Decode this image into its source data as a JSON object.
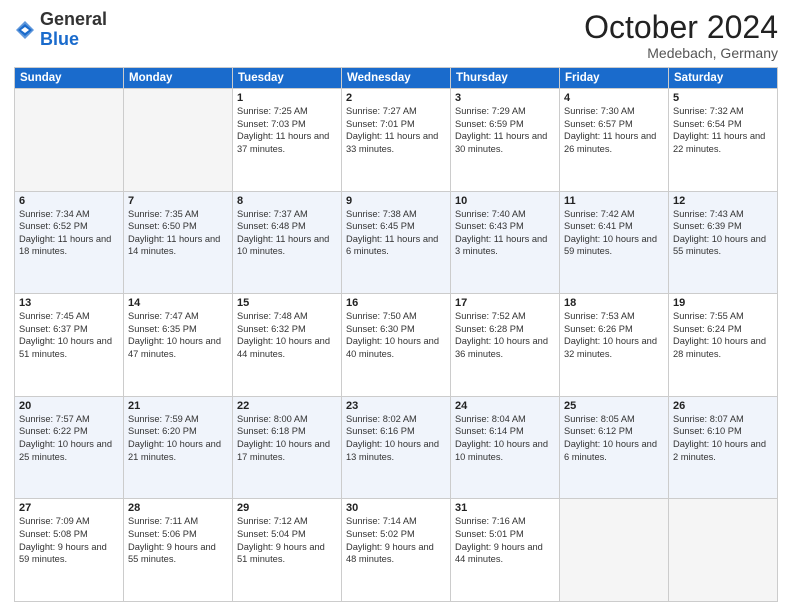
{
  "header": {
    "logo": {
      "line1": "General",
      "line2": "Blue"
    },
    "title": "October 2024",
    "location": "Medebach, Germany"
  },
  "weekdays": [
    "Sunday",
    "Monday",
    "Tuesday",
    "Wednesday",
    "Thursday",
    "Friday",
    "Saturday"
  ],
  "weeks": [
    [
      {
        "day": "",
        "info": ""
      },
      {
        "day": "",
        "info": ""
      },
      {
        "day": "1",
        "info": "Sunrise: 7:25 AM\nSunset: 7:03 PM\nDaylight: 11 hours\nand 37 minutes."
      },
      {
        "day": "2",
        "info": "Sunrise: 7:27 AM\nSunset: 7:01 PM\nDaylight: 11 hours\nand 33 minutes."
      },
      {
        "day": "3",
        "info": "Sunrise: 7:29 AM\nSunset: 6:59 PM\nDaylight: 11 hours\nand 30 minutes."
      },
      {
        "day": "4",
        "info": "Sunrise: 7:30 AM\nSunset: 6:57 PM\nDaylight: 11 hours\nand 26 minutes."
      },
      {
        "day": "5",
        "info": "Sunrise: 7:32 AM\nSunset: 6:54 PM\nDaylight: 11 hours\nand 22 minutes."
      }
    ],
    [
      {
        "day": "6",
        "info": "Sunrise: 7:34 AM\nSunset: 6:52 PM\nDaylight: 11 hours\nand 18 minutes."
      },
      {
        "day": "7",
        "info": "Sunrise: 7:35 AM\nSunset: 6:50 PM\nDaylight: 11 hours\nand 14 minutes."
      },
      {
        "day": "8",
        "info": "Sunrise: 7:37 AM\nSunset: 6:48 PM\nDaylight: 11 hours\nand 10 minutes."
      },
      {
        "day": "9",
        "info": "Sunrise: 7:38 AM\nSunset: 6:45 PM\nDaylight: 11 hours\nand 6 minutes."
      },
      {
        "day": "10",
        "info": "Sunrise: 7:40 AM\nSunset: 6:43 PM\nDaylight: 11 hours\nand 3 minutes."
      },
      {
        "day": "11",
        "info": "Sunrise: 7:42 AM\nSunset: 6:41 PM\nDaylight: 10 hours\nand 59 minutes."
      },
      {
        "day": "12",
        "info": "Sunrise: 7:43 AM\nSunset: 6:39 PM\nDaylight: 10 hours\nand 55 minutes."
      }
    ],
    [
      {
        "day": "13",
        "info": "Sunrise: 7:45 AM\nSunset: 6:37 PM\nDaylight: 10 hours\nand 51 minutes."
      },
      {
        "day": "14",
        "info": "Sunrise: 7:47 AM\nSunset: 6:35 PM\nDaylight: 10 hours\nand 47 minutes."
      },
      {
        "day": "15",
        "info": "Sunrise: 7:48 AM\nSunset: 6:32 PM\nDaylight: 10 hours\nand 44 minutes."
      },
      {
        "day": "16",
        "info": "Sunrise: 7:50 AM\nSunset: 6:30 PM\nDaylight: 10 hours\nand 40 minutes."
      },
      {
        "day": "17",
        "info": "Sunrise: 7:52 AM\nSunset: 6:28 PM\nDaylight: 10 hours\nand 36 minutes."
      },
      {
        "day": "18",
        "info": "Sunrise: 7:53 AM\nSunset: 6:26 PM\nDaylight: 10 hours\nand 32 minutes."
      },
      {
        "day": "19",
        "info": "Sunrise: 7:55 AM\nSunset: 6:24 PM\nDaylight: 10 hours\nand 28 minutes."
      }
    ],
    [
      {
        "day": "20",
        "info": "Sunrise: 7:57 AM\nSunset: 6:22 PM\nDaylight: 10 hours\nand 25 minutes."
      },
      {
        "day": "21",
        "info": "Sunrise: 7:59 AM\nSunset: 6:20 PM\nDaylight: 10 hours\nand 21 minutes."
      },
      {
        "day": "22",
        "info": "Sunrise: 8:00 AM\nSunset: 6:18 PM\nDaylight: 10 hours\nand 17 minutes."
      },
      {
        "day": "23",
        "info": "Sunrise: 8:02 AM\nSunset: 6:16 PM\nDaylight: 10 hours\nand 13 minutes."
      },
      {
        "day": "24",
        "info": "Sunrise: 8:04 AM\nSunset: 6:14 PM\nDaylight: 10 hours\nand 10 minutes."
      },
      {
        "day": "25",
        "info": "Sunrise: 8:05 AM\nSunset: 6:12 PM\nDaylight: 10 hours\nand 6 minutes."
      },
      {
        "day": "26",
        "info": "Sunrise: 8:07 AM\nSunset: 6:10 PM\nDaylight: 10 hours\nand 2 minutes."
      }
    ],
    [
      {
        "day": "27",
        "info": "Sunrise: 7:09 AM\nSunset: 5:08 PM\nDaylight: 9 hours\nand 59 minutes."
      },
      {
        "day": "28",
        "info": "Sunrise: 7:11 AM\nSunset: 5:06 PM\nDaylight: 9 hours\nand 55 minutes."
      },
      {
        "day": "29",
        "info": "Sunrise: 7:12 AM\nSunset: 5:04 PM\nDaylight: 9 hours\nand 51 minutes."
      },
      {
        "day": "30",
        "info": "Sunrise: 7:14 AM\nSunset: 5:02 PM\nDaylight: 9 hours\nand 48 minutes."
      },
      {
        "day": "31",
        "info": "Sunrise: 7:16 AM\nSunset: 5:01 PM\nDaylight: 9 hours\nand 44 minutes."
      },
      {
        "day": "",
        "info": ""
      },
      {
        "day": "",
        "info": ""
      }
    ]
  ]
}
